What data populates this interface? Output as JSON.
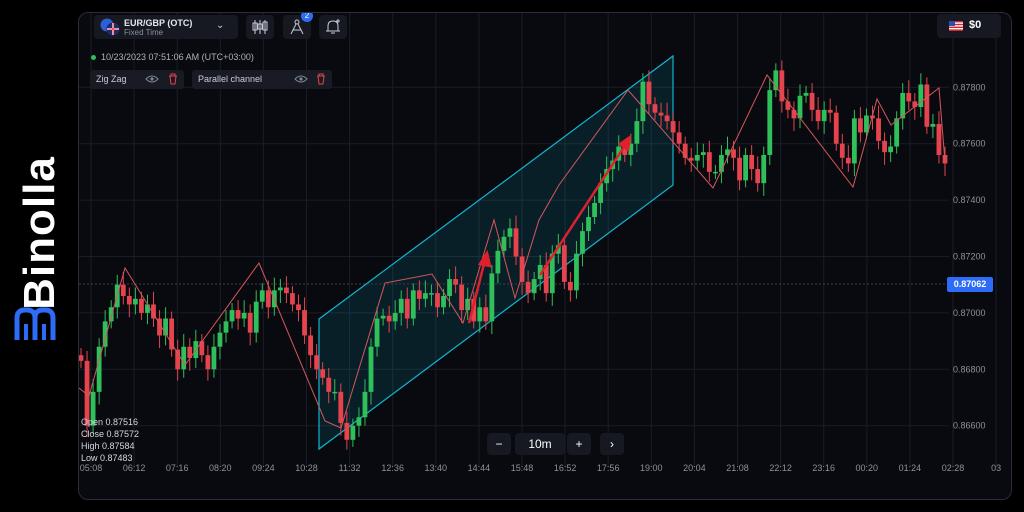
{
  "brand": {
    "name": "Binolla"
  },
  "topbar": {
    "asset_name": "EUR/GBP (OTC)",
    "asset_type": "Fixed Time",
    "indicator_badge": "2",
    "balance": "$0",
    "icons": [
      "candlestick-chart-icon",
      "drawing-tools-icon",
      "add-alert-icon",
      "caret-down-icon"
    ]
  },
  "chart": {
    "timestamp": "10/23/2023  07:51:06 AM  (UTC+03:00)",
    "indicators": [
      {
        "label": "Zig Zag"
      },
      {
        "label": "Parallel channel"
      }
    ],
    "current_price": "0.87062",
    "ohlc": {
      "open": "Open  0.87516",
      "close": "Close  0.87572",
      "high": "High  0.87584",
      "low": "Low  0.87483"
    },
    "timeframe": "10m",
    "colors": {
      "up": "#2fbf5b",
      "down": "#e5444f",
      "channel": "#12b5d0",
      "accent": "#2d6cf6",
      "arrow": "#e0212d"
    }
  },
  "chart_data": {
    "type": "candlestick",
    "x_ticks": [
      "05:08",
      "06:12",
      "07:16",
      "08:20",
      "09:24",
      "10:28",
      "11:32",
      "12:36",
      "13:40",
      "14:44",
      "15:48",
      "16:52",
      "17:56",
      "19:00",
      "20:04",
      "21:08",
      "22:12",
      "23:16",
      "00:20",
      "01:24",
      "02:28",
      "03"
    ],
    "y_ticks": [
      "0.87800",
      "0.87600",
      "0.87400",
      "0.87200",
      "0.87000",
      "0.86800",
      "0.86600"
    ],
    "ylim": [
      0.8645,
      0.8795
    ],
    "y_tick_values": [
      0.878,
      0.876,
      0.874,
      0.872,
      0.87,
      0.868,
      0.866
    ],
    "current_price": 0.87062,
    "close_series": [
      0.8683,
      0.866,
      0.8672,
      0.8688,
      0.8697,
      0.8702,
      0.871,
      0.8706,
      0.8703,
      0.8705,
      0.87,
      0.8703,
      0.8698,
      0.8692,
      0.8698,
      0.8687,
      0.868,
      0.8688,
      0.8684,
      0.869,
      0.8685,
      0.868,
      0.8688,
      0.8693,
      0.8697,
      0.8701,
      0.8698,
      0.87,
      0.8693,
      0.8704,
      0.8708,
      0.8702,
      0.8708,
      0.8709,
      0.8707,
      0.8703,
      0.8701,
      0.8692,
      0.8685,
      0.868,
      0.8677,
      0.8672,
      0.8672,
      0.8661,
      0.8655,
      0.866,
      0.8663,
      0.8672,
      0.8688,
      0.8698,
      0.8699,
      0.8697,
      0.87,
      0.8705,
      0.8698,
      0.8708,
      0.8705,
      0.8707,
      0.8707,
      0.8702,
      0.8706,
      0.8712,
      0.871,
      0.8701,
      0.8705,
      0.8697,
      0.8702,
      0.8697,
      0.8714,
      0.8722,
      0.8727,
      0.873,
      0.872,
      0.8711,
      0.8707,
      0.8712,
      0.8717,
      0.8707,
      0.8721,
      0.8724,
      0.8711,
      0.8708,
      0.8721,
      0.8729,
      0.8734,
      0.8739,
      0.8746,
      0.8751,
      0.8754,
      0.8759,
      0.8756,
      0.876,
      0.8768,
      0.8782,
      0.8774,
      0.8771,
      0.877,
      0.8768,
      0.8764,
      0.876,
      0.8755,
      0.8754,
      0.8756,
      0.8757,
      0.875,
      0.875,
      0.8756,
      0.8758,
      0.8755,
      0.8747,
      0.8756,
      0.8751,
      0.8746,
      0.8756,
      0.8779,
      0.8786,
      0.8775,
      0.8772,
      0.8769,
      0.8777,
      0.8778,
      0.8772,
      0.8768,
      0.8772,
      0.8771,
      0.876,
      0.8755,
      0.8753,
      0.8769,
      0.8764,
      0.877,
      0.8769,
      0.8761,
      0.8757,
      0.8759,
      0.8769,
      0.8778,
      0.8775,
      0.8773,
      0.8781,
      0.8766,
      0.8767,
      0.8756,
      0.8753
    ]
  },
  "zoom_controls": {
    "minus": "−",
    "value": "10m",
    "plus": "+",
    "next": "›"
  }
}
